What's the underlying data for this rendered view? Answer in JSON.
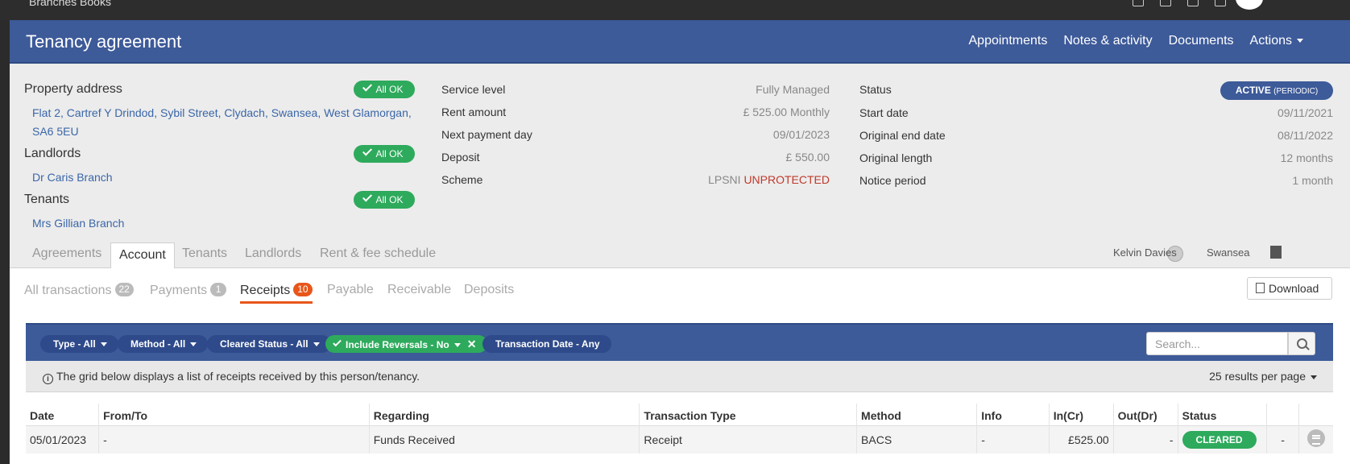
{
  "topbar": {
    "brand": "Branches Books"
  },
  "header": {
    "title": "Tenancy agreement",
    "nav": [
      "Appointments",
      "Notes & activity",
      "Documents",
      "Actions"
    ]
  },
  "property": {
    "address_label": "Property address",
    "address_line1": "Flat 2, Cartref Y Drindod, Sybil Street, Clydach, Swansea, West Glamorgan,",
    "address_line2": "SA6 5EU",
    "landlords_label": "Landlords",
    "landlord": "Dr Caris Branch",
    "tenants_label": "Tenants",
    "tenant": "Mrs Gillian Branch",
    "ok_label": "All OK"
  },
  "details": {
    "service_level_label": "Service level",
    "service_level": "Fully Managed",
    "rent_label": "Rent amount",
    "rent": "£ 525.00 Monthly",
    "next_payment_label": "Next payment day",
    "next_payment": "09/01/2023",
    "deposit_label": "Deposit",
    "deposit": "£ 550.00",
    "scheme_label": "Scheme",
    "scheme_name": "LPSNI",
    "scheme_status": "UNPROTECTED"
  },
  "status": {
    "status_label": "Status",
    "badge_main": "ACTIVE",
    "badge_sub": "(PERIODIC)",
    "start_label": "Start date",
    "start": "09/11/2021",
    "orig_end_label": "Original end date",
    "orig_end": "08/11/2022",
    "orig_length_label": "Original length",
    "orig_length": "12 months",
    "notice_label": "Notice period",
    "notice": "1 month"
  },
  "tabs": [
    "Agreements",
    "Account",
    "Tenants",
    "Landlords",
    "Rent & fee schedule"
  ],
  "user": {
    "name": "Kelvin Davies",
    "branch": "Swansea"
  },
  "subtabs": [
    {
      "label": "All transactions",
      "count": "22"
    },
    {
      "label": "Payments",
      "count": "1"
    },
    {
      "label": "Receipts",
      "count": "10"
    },
    {
      "label": "Payable"
    },
    {
      "label": "Receivable"
    },
    {
      "label": "Deposits"
    }
  ],
  "download_label": "Download",
  "filters": [
    "Type - All",
    "Method - All",
    "Cleared Status - All",
    "Include Reversals - No",
    "Transaction Date - Any"
  ],
  "search_placeholder": "Search...",
  "info_text": "The grid below displays a list of receipts received by this person/tenancy.",
  "per_page": "25 results per page",
  "table": {
    "columns": [
      "Date",
      "From/To",
      "Regarding",
      "Transaction Type",
      "Method",
      "Info",
      "In(Cr)",
      "Out(Dr)",
      "Status",
      ""
    ],
    "rows": [
      {
        "date": "05/01/2023",
        "from_to": "-",
        "regarding": "Funds Received",
        "type": "Receipt",
        "method": "BACS",
        "info": "-",
        "in": "£525.00",
        "out": "-",
        "status": "CLEARED",
        "extra": "-"
      }
    ]
  }
}
